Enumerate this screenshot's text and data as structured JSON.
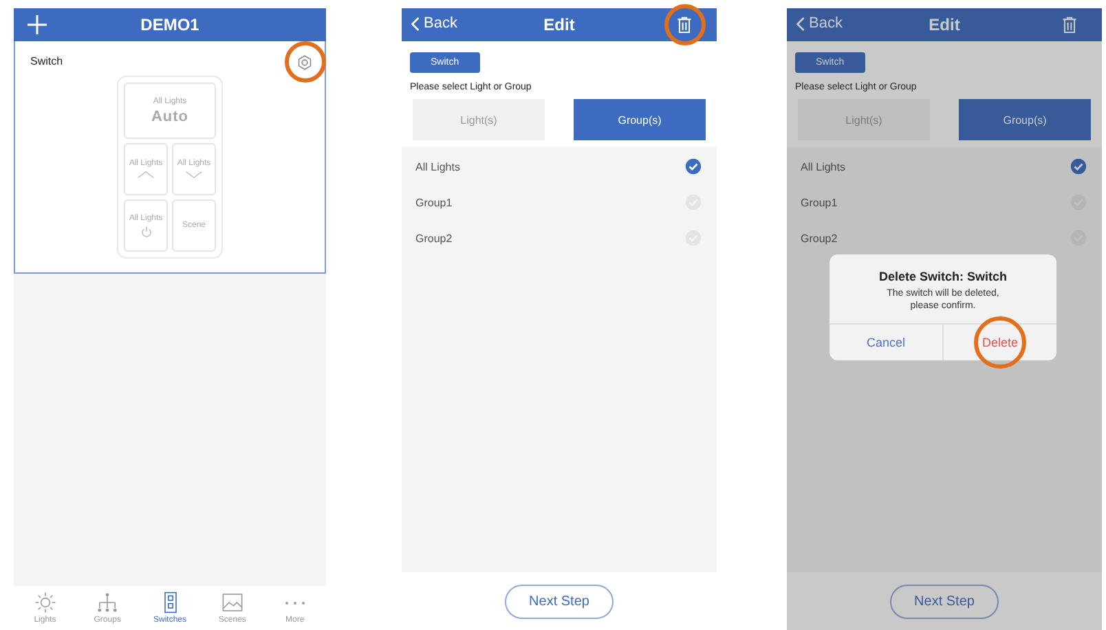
{
  "screens": [
    {
      "kind": "home",
      "header": {
        "title": "DEMO1"
      },
      "card": {
        "label": "Switch",
        "settings_highlighted": true,
        "keys": [
          {
            "kind": "auto",
            "label": "All Lights",
            "value": "Auto"
          },
          {
            "kind": "up",
            "label": "All Lights"
          },
          {
            "kind": "down",
            "label": "All Lights"
          },
          {
            "kind": "power",
            "label": "All Lights"
          },
          {
            "kind": "plain",
            "label": "Scene"
          }
        ]
      },
      "tabs": [
        {
          "label": "Lights",
          "selected": false
        },
        {
          "label": "Groups",
          "selected": false
        },
        {
          "label": "Switches",
          "selected": true
        },
        {
          "label": "Scenes",
          "selected": false
        },
        {
          "label": "More",
          "selected": false
        }
      ]
    },
    {
      "kind": "edit",
      "header": {
        "back": "Back",
        "title": "Edit",
        "trash_highlighted": true
      },
      "chip": "Switch",
      "prompt": "Please select Light or Group",
      "segments": [
        {
          "label": "Light(s)",
          "selected": false
        },
        {
          "label": "Group(s)",
          "selected": true
        }
      ],
      "items": [
        {
          "label": "All Lights",
          "checked": true
        },
        {
          "label": "Group1",
          "checked": false
        },
        {
          "label": "Group2",
          "checked": false
        }
      ],
      "next": "Next Step"
    },
    {
      "kind": "edit",
      "dimmed": true,
      "header": {
        "back": "Back",
        "title": "Edit"
      },
      "chip": "Switch",
      "prompt": "Please select Light or Group",
      "segments": [
        {
          "label": "Light(s)",
          "selected": false
        },
        {
          "label": "Group(s)",
          "selected": true
        }
      ],
      "items": [
        {
          "label": "All Lights",
          "checked": true
        },
        {
          "label": "Group1",
          "checked": false
        },
        {
          "label": "Group2",
          "checked": false
        }
      ],
      "next": "Next Step",
      "dialog": {
        "title": "Delete Switch: Switch",
        "message": "The switch will be deleted, please confirm.",
        "buttons": [
          {
            "label": "Cancel",
            "kind": "cancel",
            "highlighted": false
          },
          {
            "label": "Delete",
            "kind": "destructive",
            "highlighted": true
          }
        ]
      }
    }
  ]
}
